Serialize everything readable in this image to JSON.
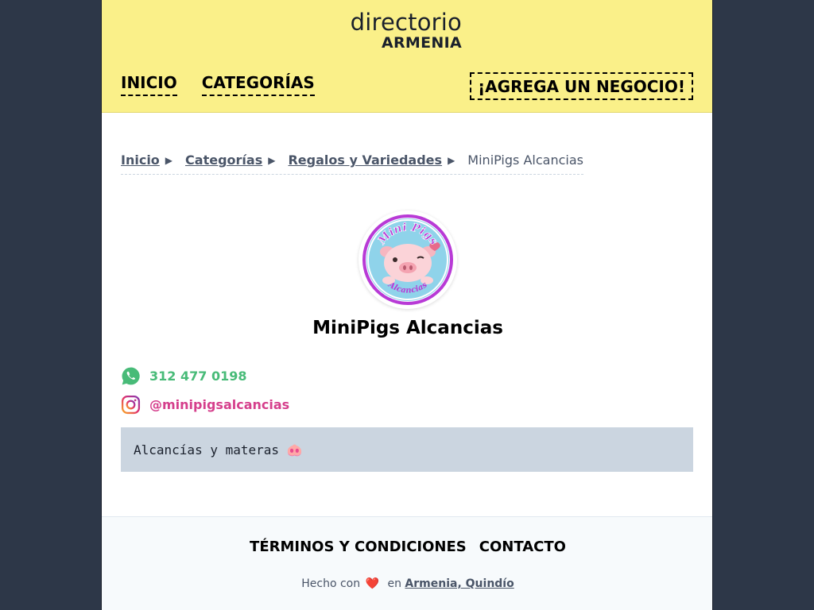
{
  "header": {
    "logo_line1": "directorio",
    "logo_line2": "ARMENIA",
    "nav": [
      {
        "label": "INICIO"
      },
      {
        "label": "CATEGORÍAS"
      }
    ],
    "cta_label": "¡AGREGA UN NEGOCIO!"
  },
  "breadcrumb": {
    "items": [
      {
        "label": "Inicio"
      },
      {
        "label": "Categorías"
      },
      {
        "label": "Regalos y Variedades"
      }
    ],
    "current": "MiniPigs Alcancias"
  },
  "business": {
    "name": "MiniPigs Alcancias",
    "logo_text_top": "Mini Pigs",
    "logo_text_bottom": "Alcancias",
    "phone": "312 477 0198",
    "instagram": "@minipigsalcancias",
    "description": "Alcancías y materas 🐽"
  },
  "footer": {
    "links": [
      {
        "label": "TÉRMINOS Y CONDICIONES"
      },
      {
        "label": "CONTACTO"
      }
    ],
    "made_prefix": "Hecho con",
    "made_heart": "❤️",
    "made_in": "en",
    "made_place": "Armenia, Quindío"
  },
  "colors": {
    "header_bg": "#faf089",
    "page_bg": "#2d3748",
    "whatsapp": "#48bb78",
    "instagram": "#d53f8c",
    "description_bg": "#cbd5e0"
  },
  "icons": [
    "whatsapp-icon",
    "instagram-icon",
    "breadcrumb-arrow-icon",
    "heart-icon"
  ]
}
